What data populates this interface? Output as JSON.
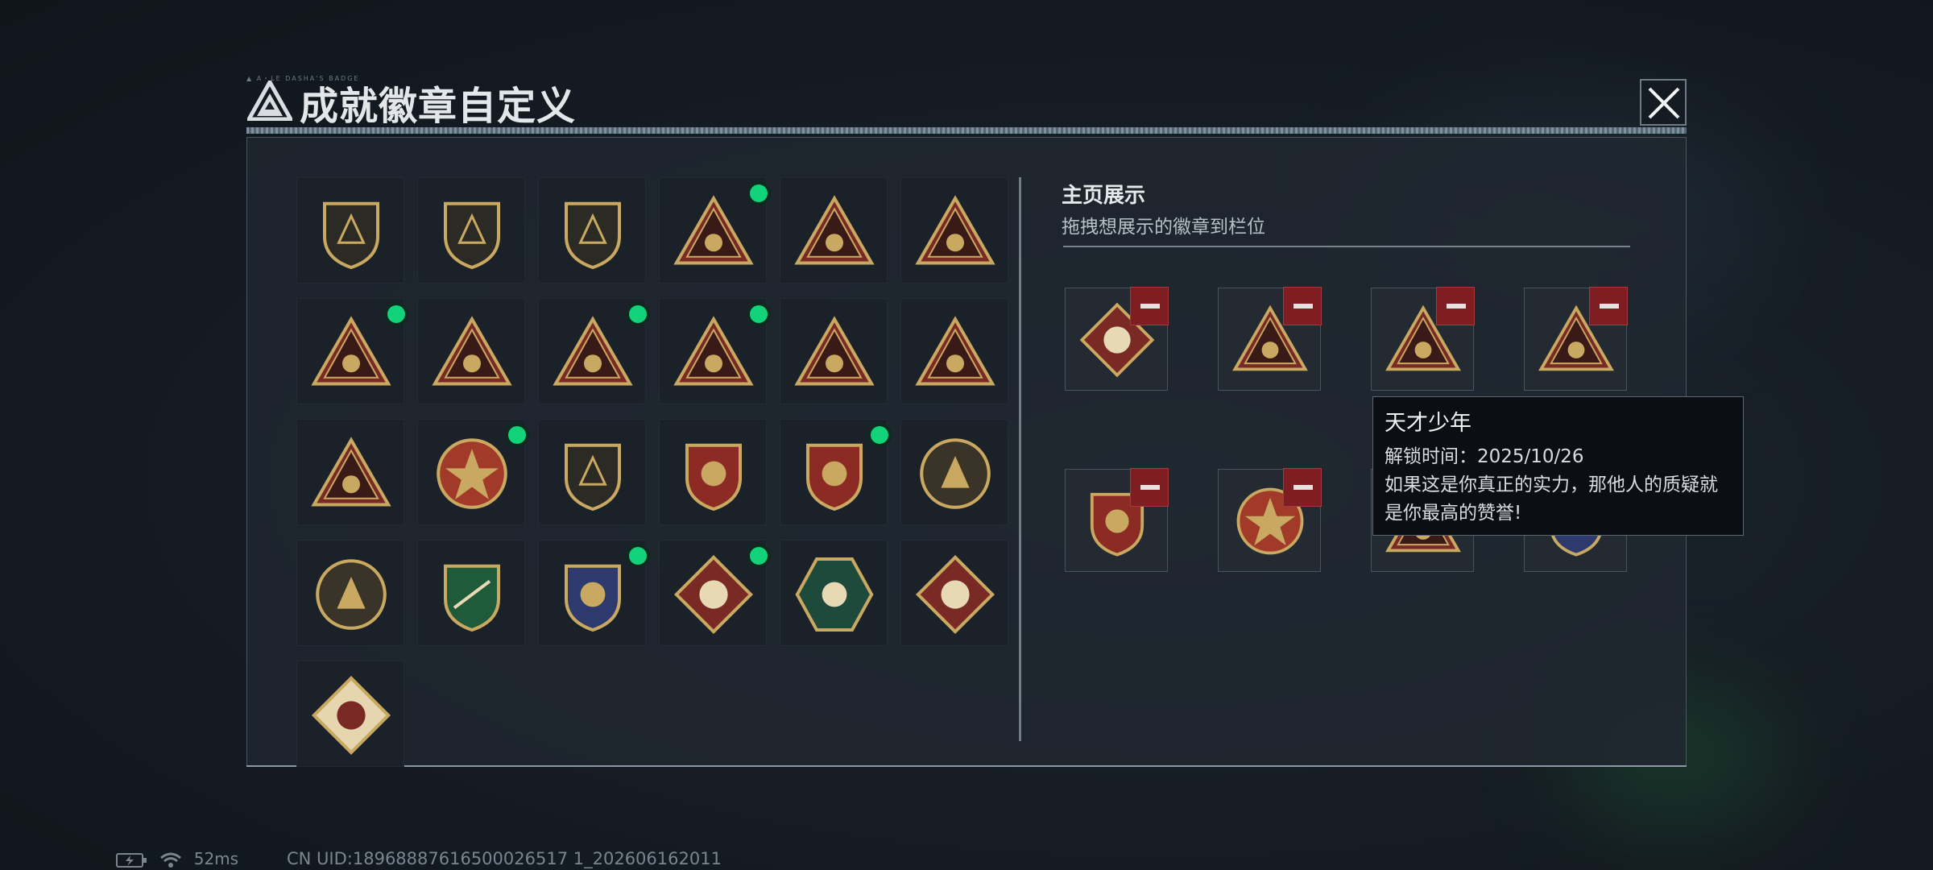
{
  "window": {
    "title": "成就徽章自定义",
    "top_line": "▲ A・LE DASHA'S BADGE"
  },
  "close_icon": "close-icon",
  "badges": [
    {
      "name": "delta-logo-shield",
      "selected": false
    },
    {
      "name": "helicopter-shield",
      "selected": false
    },
    {
      "name": "dagger-shield",
      "selected": false
    },
    {
      "name": "s7-triangle",
      "selected": true
    },
    {
      "name": "s8-triangle",
      "selected": false
    },
    {
      "name": "s9-triangle",
      "selected": false
    },
    {
      "name": "ship-triangle",
      "selected": true
    },
    {
      "name": "number-one-triangle",
      "selected": false
    },
    {
      "name": "usb-triangle",
      "selected": true
    },
    {
      "name": "meditation-triangle",
      "selected": true
    },
    {
      "name": "hands-triangle",
      "selected": false
    },
    {
      "name": "soldiers-triangle",
      "selected": false
    },
    {
      "name": "soldiers-pedestal",
      "selected": false
    },
    {
      "name": "star-medal",
      "selected": true
    },
    {
      "name": "hand-shield",
      "selected": false
    },
    {
      "name": "diamond-laurel-shield",
      "selected": false
    },
    {
      "name": "diamond-laurel-shield-2",
      "selected": true
    },
    {
      "name": "lion-seal",
      "selected": false
    },
    {
      "name": "tank-sunburst",
      "selected": false
    },
    {
      "name": "green-rifle-shield",
      "selected": false
    },
    {
      "name": "blue-swords-shield",
      "selected": true
    },
    {
      "name": "wolf-diamond",
      "selected": true
    },
    {
      "name": "hornet-hexagon",
      "selected": false
    },
    {
      "name": "dragon-diamond",
      "selected": false
    },
    {
      "name": "serpent-diamond",
      "selected": false
    }
  ],
  "display": {
    "title": "主页展示",
    "subtitle": "拖拽想展示的徽章到栏位",
    "slots": [
      {
        "badge": "wolf-diamond"
      },
      {
        "badge": "ship-triangle"
      },
      {
        "badge": "usb-triangle"
      },
      {
        "badge": "meditation-triangle"
      },
      {
        "badge": "diamond-laurel-shield-2"
      },
      {
        "badge": "star-medal"
      },
      {
        "badge": "usb-triangle"
      },
      {
        "badge": "blue-swords-shield"
      }
    ]
  },
  "tooltip": {
    "name": "天才少年",
    "time_label": "解锁时间：2025/10/26",
    "desc_line1": "如果这是你真正的实力，那他人的质疑就",
    "desc_line2": "是你最高的赞誉!"
  },
  "status_bar": {
    "ping": "52ms",
    "uid": "CN UID:18968887616500026517 1_202606162011"
  },
  "colors": {
    "accent_green": "#13d37a",
    "remove_red": "#7e1d22",
    "gold": "#c9a961",
    "badge_red": "#7a2a24"
  }
}
